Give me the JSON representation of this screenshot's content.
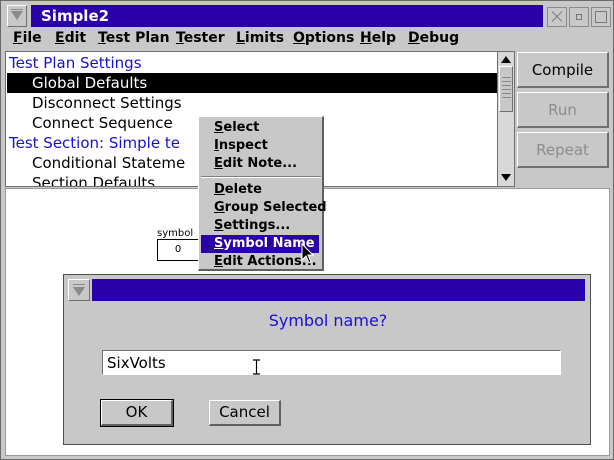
{
  "window": {
    "title": "Simple2"
  },
  "menubar": {
    "items": [
      {
        "mnemonic": "F",
        "rest": "ile"
      },
      {
        "mnemonic": "E",
        "rest": "dit"
      },
      {
        "mnemonic": "T",
        "rest": "est Plan"
      },
      {
        "mnemonic": "T",
        "rest": "ester"
      },
      {
        "mnemonic": "L",
        "rest": "imits"
      },
      {
        "mnemonic": "O",
        "rest": "ptions"
      },
      {
        "mnemonic": "H",
        "rest": "elp"
      },
      {
        "mnemonic": "D",
        "rest": "ebug"
      }
    ]
  },
  "tree": {
    "rows": [
      {
        "label": "Test Plan Settings",
        "kind": "section"
      },
      {
        "label": "Global Defaults",
        "kind": "child",
        "selected": true
      },
      {
        "label": "Disconnect Settings",
        "kind": "child"
      },
      {
        "label": "Connect Sequence",
        "kind": "child"
      },
      {
        "label": "Test Section: Simple te",
        "kind": "section"
      },
      {
        "label": "Conditional Stateme",
        "kind": "child"
      },
      {
        "label": "Section Defaults",
        "kind": "child"
      }
    ]
  },
  "side_buttons": {
    "compile": "Compile",
    "run": "Run",
    "repeat": "Repeat"
  },
  "canvas": {
    "symbol_label": "symbol",
    "symbol_value": "0"
  },
  "context_menu": {
    "group1": [
      {
        "mnemonic": "S",
        "rest": "elect"
      },
      {
        "mnemonic": "I",
        "rest": "nspect"
      },
      {
        "mnemonic": "E",
        "rest": "dit Note..."
      }
    ],
    "group2": [
      {
        "mnemonic": "D",
        "rest": "elete"
      },
      {
        "mnemonic": "G",
        "rest": "roup Selected"
      },
      {
        "mnemonic": "S",
        "rest": "ettings..."
      },
      {
        "mnemonic": "S",
        "rest": "ymbol Name"
      },
      {
        "mnemonic": "E",
        "rest": "dit Actions..."
      }
    ],
    "highlighted_index": 3
  },
  "dialog": {
    "prompt": "Symbol name?",
    "input_value": "SixVolts",
    "ok_label": "OK",
    "cancel_label": "Cancel"
  },
  "colors": {
    "title_bar": "#2a00a8",
    "section_text": "#1a10d0",
    "disabled_text": "#8c8c8c"
  }
}
